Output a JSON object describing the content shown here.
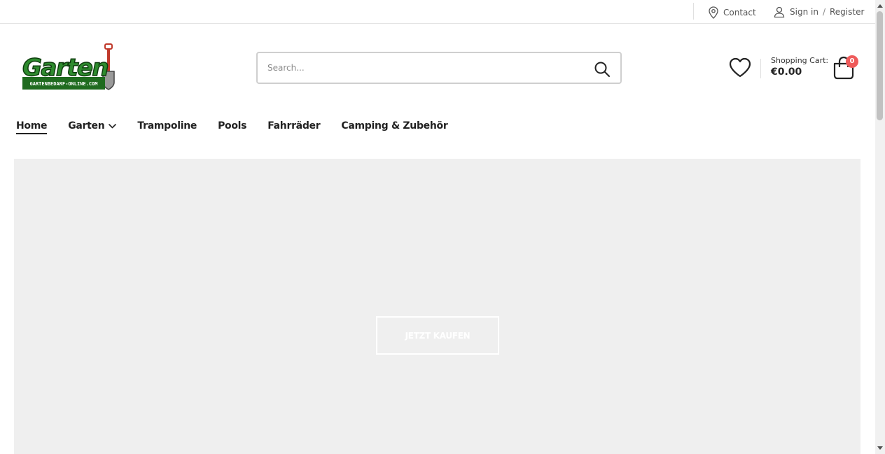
{
  "topbar": {
    "contact_label": "Contact",
    "signin_label": "Sign in",
    "separator": "/",
    "register_label": "Register"
  },
  "logo": {
    "text": "Garten",
    "subtext": "GARTENBEDARF-ONLINE.COM"
  },
  "search": {
    "placeholder": "Search...",
    "value": ""
  },
  "cart": {
    "label": "Shopping Cart:",
    "total": "€0.00",
    "count": "0"
  },
  "nav": {
    "items": [
      {
        "label": "Home",
        "active": true
      },
      {
        "label": "Garten",
        "dropdown": true
      },
      {
        "label": "Trampoline"
      },
      {
        "label": "Pools"
      },
      {
        "label": "Fahrräder"
      },
      {
        "label": "Camping & Zubehör"
      }
    ]
  },
  "hero": {
    "button_label": "JETZT KAUFEN"
  },
  "colors": {
    "accent_badge": "#ef5b5b",
    "logo_green": "#2e8b2e",
    "hero_bg": "#efefef"
  }
}
